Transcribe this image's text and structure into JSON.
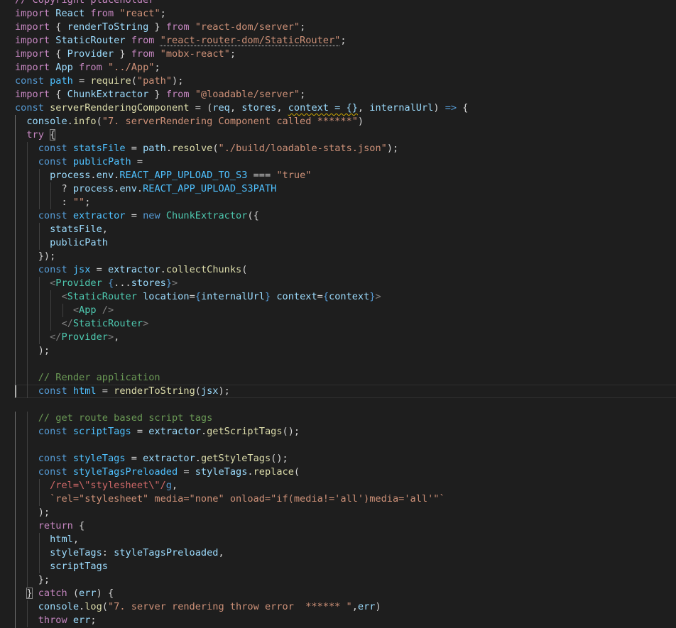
{
  "editor": {
    "language": "javascript",
    "cursor_line": 29,
    "lines": [
      {
        "indent": 0,
        "tokens": [
          [
            "ctl",
            "// Copyright placeholder "
          ]
        ]
      },
      {
        "indent": 0,
        "tokens": [
          [
            "ctl",
            "import"
          ],
          [
            "pl",
            " "
          ],
          [
            "var",
            "React"
          ],
          [
            "pl",
            " "
          ],
          [
            "ctl",
            "from"
          ],
          [
            "pl",
            " "
          ],
          [
            "str",
            "\"react\""
          ],
          [
            "pl",
            ";"
          ]
        ]
      },
      {
        "indent": 0,
        "tokens": [
          [
            "ctl",
            "import"
          ],
          [
            "pl",
            " { "
          ],
          [
            "var",
            "renderToString"
          ],
          [
            "pl",
            " } "
          ],
          [
            "ctl",
            "from"
          ],
          [
            "pl",
            " "
          ],
          [
            "str",
            "\"react-dom/server\""
          ],
          [
            "pl",
            ";"
          ]
        ]
      },
      {
        "indent": 0,
        "tokens": [
          [
            "ctl",
            "import"
          ],
          [
            "pl",
            " "
          ],
          [
            "var",
            "StaticRouter"
          ],
          [
            "pl",
            " "
          ],
          [
            "ctl",
            "from"
          ],
          [
            "pl",
            " "
          ],
          [
            "str",
            "\"react-router-dom/StaticRouter\"",
            "dots"
          ],
          [
            "pl",
            ";"
          ]
        ]
      },
      {
        "indent": 0,
        "tokens": [
          [
            "ctl",
            "import"
          ],
          [
            "pl",
            " { "
          ],
          [
            "var",
            "Provider"
          ],
          [
            "pl",
            " } "
          ],
          [
            "ctl",
            "from"
          ],
          [
            "pl",
            " "
          ],
          [
            "str",
            "\"mobx-react\""
          ],
          [
            "pl",
            ";"
          ]
        ]
      },
      {
        "indent": 0,
        "tokens": [
          [
            "ctl",
            "import"
          ],
          [
            "pl",
            " "
          ],
          [
            "var",
            "App"
          ],
          [
            "pl",
            " "
          ],
          [
            "ctl",
            "from"
          ],
          [
            "pl",
            " "
          ],
          [
            "str",
            "\"../App\""
          ],
          [
            "pl",
            ";"
          ]
        ]
      },
      {
        "indent": 0,
        "tokens": [
          [
            "kw",
            "const"
          ],
          [
            "pl",
            " "
          ],
          [
            "cst",
            "path"
          ],
          [
            "pl",
            " = "
          ],
          [
            "fn",
            "require"
          ],
          [
            "pl",
            "("
          ],
          [
            "str",
            "\"path\""
          ],
          [
            "pl",
            ");"
          ]
        ]
      },
      {
        "indent": 0,
        "tokens": [
          [
            "ctl",
            "import"
          ],
          [
            "pl",
            " { "
          ],
          [
            "var",
            "ChunkExtractor"
          ],
          [
            "pl",
            " } "
          ],
          [
            "ctl",
            "from"
          ],
          [
            "pl",
            " "
          ],
          [
            "str",
            "\"@loadable/server\""
          ],
          [
            "pl",
            ";"
          ]
        ]
      },
      {
        "indent": 0,
        "tokens": [
          [
            "kw",
            "const"
          ],
          [
            "pl",
            " "
          ],
          [
            "fn",
            "serverRenderingComponent"
          ],
          [
            "pl",
            " = ("
          ],
          [
            "var",
            "req"
          ],
          [
            "pl",
            ", "
          ],
          [
            "var",
            "stores"
          ],
          [
            "pl",
            ", "
          ],
          [
            "var",
            "context = {}",
            "squig"
          ],
          [
            "pl",
            ", "
          ],
          [
            "var",
            "internalUrl"
          ],
          [
            "pl",
            ") "
          ],
          [
            "kw",
            "=>"
          ],
          [
            "pl",
            " {"
          ]
        ]
      },
      {
        "indent": 1,
        "tokens": [
          [
            "var",
            "console"
          ],
          [
            "pl",
            "."
          ],
          [
            "fn",
            "info"
          ],
          [
            "pl",
            "("
          ],
          [
            "str",
            "\"7. serverRendering Component called ******\""
          ],
          [
            "pl",
            ")"
          ]
        ]
      },
      {
        "indent": 1,
        "tokens": [
          [
            "ctl",
            "try"
          ],
          [
            "pl",
            " "
          ],
          [
            "pl",
            "{",
            "bm"
          ]
        ]
      },
      {
        "indent": 2,
        "tokens": [
          [
            "kw",
            "const"
          ],
          [
            "pl",
            " "
          ],
          [
            "cst",
            "statsFile"
          ],
          [
            "pl",
            " = "
          ],
          [
            "var",
            "path"
          ],
          [
            "pl",
            "."
          ],
          [
            "fn",
            "resolve"
          ],
          [
            "pl",
            "("
          ],
          [
            "str",
            "\"./build/loadable-stats.json\""
          ],
          [
            "pl",
            ");"
          ]
        ]
      },
      {
        "indent": 2,
        "tokens": [
          [
            "kw",
            "const"
          ],
          [
            "pl",
            " "
          ],
          [
            "cst",
            "publicPath"
          ],
          [
            "pl",
            " ="
          ]
        ]
      },
      {
        "indent": 3,
        "tokens": [
          [
            "var",
            "process"
          ],
          [
            "pl",
            "."
          ],
          [
            "var",
            "env"
          ],
          [
            "pl",
            "."
          ],
          [
            "cst",
            "REACT_APP_UPLOAD_TO_S3"
          ],
          [
            "pl",
            " === "
          ],
          [
            "str",
            "\"true\""
          ]
        ]
      },
      {
        "indent": 4,
        "tokens": [
          [
            "pl",
            "? "
          ],
          [
            "var",
            "process"
          ],
          [
            "pl",
            "."
          ],
          [
            "var",
            "env"
          ],
          [
            "pl",
            "."
          ],
          [
            "cst",
            "REACT_APP_UPLOAD_S3PATH"
          ]
        ]
      },
      {
        "indent": 4,
        "tokens": [
          [
            "pl",
            ": "
          ],
          [
            "str",
            "\"\""
          ],
          [
            "pl",
            ";"
          ]
        ]
      },
      {
        "indent": 2,
        "tokens": [
          [
            "kw",
            "const"
          ],
          [
            "pl",
            " "
          ],
          [
            "cst",
            "extractor"
          ],
          [
            "pl",
            " = "
          ],
          [
            "kw",
            "new"
          ],
          [
            "pl",
            " "
          ],
          [
            "cls",
            "ChunkExtractor"
          ],
          [
            "pl",
            "({"
          ]
        ]
      },
      {
        "indent": 3,
        "tokens": [
          [
            "var",
            "statsFile"
          ],
          [
            "pl",
            ","
          ]
        ]
      },
      {
        "indent": 3,
        "tokens": [
          [
            "var",
            "publicPath"
          ]
        ]
      },
      {
        "indent": 2,
        "tokens": [
          [
            "pl",
            "});"
          ]
        ]
      },
      {
        "indent": 2,
        "tokens": [
          [
            "kw",
            "const"
          ],
          [
            "pl",
            " "
          ],
          [
            "cst",
            "jsx"
          ],
          [
            "pl",
            " = "
          ],
          [
            "var",
            "extractor"
          ],
          [
            "pl",
            "."
          ],
          [
            "fn",
            "collectChunks"
          ],
          [
            "pl",
            "("
          ]
        ]
      },
      {
        "indent": 3,
        "tokens": [
          [
            "tag",
            "<"
          ],
          [
            "cls",
            "Provider"
          ],
          [
            "pl",
            " "
          ],
          [
            "kw",
            "{"
          ],
          [
            "pl",
            "..."
          ],
          [
            "var",
            "stores"
          ],
          [
            "kw",
            "}"
          ],
          [
            "tag",
            ">"
          ]
        ]
      },
      {
        "indent": 4,
        "tokens": [
          [
            "tag",
            "<"
          ],
          [
            "cls",
            "StaticRouter"
          ],
          [
            "pl",
            " "
          ],
          [
            "var",
            "location"
          ],
          [
            "pl",
            "="
          ],
          [
            "kw",
            "{"
          ],
          [
            "var",
            "internalUrl"
          ],
          [
            "kw",
            "}"
          ],
          [
            "pl",
            " "
          ],
          [
            "var",
            "context"
          ],
          [
            "pl",
            "="
          ],
          [
            "kw",
            "{"
          ],
          [
            "var",
            "context"
          ],
          [
            "kw",
            "}"
          ],
          [
            "tag",
            ">"
          ]
        ]
      },
      {
        "indent": 5,
        "tokens": [
          [
            "tag",
            "<"
          ],
          [
            "cls",
            "App"
          ],
          [
            "pl",
            " "
          ],
          [
            "tag",
            "/>"
          ]
        ]
      },
      {
        "indent": 4,
        "tokens": [
          [
            "tag",
            "</"
          ],
          [
            "cls",
            "StaticRouter"
          ],
          [
            "tag",
            ">"
          ]
        ]
      },
      {
        "indent": 3,
        "tokens": [
          [
            "tag",
            "</"
          ],
          [
            "cls",
            "Provider"
          ],
          [
            "tag",
            ">"
          ],
          [
            "pl",
            ","
          ]
        ]
      },
      {
        "indent": 2,
        "tokens": [
          [
            "pl",
            ");"
          ]
        ]
      },
      {
        "indent": 2,
        "tokens": []
      },
      {
        "indent": 2,
        "tokens": [
          [
            "cmt",
            "// Render application"
          ]
        ]
      },
      {
        "indent": 2,
        "tokens": [
          [
            "kw",
            "const"
          ],
          [
            "pl",
            " "
          ],
          [
            "cst",
            "html"
          ],
          [
            "pl",
            " = "
          ],
          [
            "fn",
            "renderToString"
          ],
          [
            "pl",
            "("
          ],
          [
            "var",
            "jsx"
          ],
          [
            "pl",
            ");"
          ]
        ]
      },
      {
        "indent": 0,
        "tokens": []
      },
      {
        "indent": 2,
        "tokens": [
          [
            "cmt",
            "// get route based script tags"
          ]
        ]
      },
      {
        "indent": 2,
        "tokens": [
          [
            "kw",
            "const"
          ],
          [
            "pl",
            " "
          ],
          [
            "cst",
            "scriptTags"
          ],
          [
            "pl",
            " = "
          ],
          [
            "var",
            "extractor"
          ],
          [
            "pl",
            "."
          ],
          [
            "fn",
            "getScriptTags"
          ],
          [
            "pl",
            "();"
          ]
        ]
      },
      {
        "indent": 2,
        "tokens": []
      },
      {
        "indent": 2,
        "tokens": [
          [
            "kw",
            "const"
          ],
          [
            "pl",
            " "
          ],
          [
            "cst",
            "styleTags"
          ],
          [
            "pl",
            " = "
          ],
          [
            "var",
            "extractor"
          ],
          [
            "pl",
            "."
          ],
          [
            "fn",
            "getStyleTags"
          ],
          [
            "pl",
            "();"
          ]
        ]
      },
      {
        "indent": 2,
        "tokens": [
          [
            "kw",
            "const"
          ],
          [
            "pl",
            " "
          ],
          [
            "cst",
            "styleTagsPreloaded"
          ],
          [
            "pl",
            " = "
          ],
          [
            "var",
            "styleTags"
          ],
          [
            "pl",
            "."
          ],
          [
            "fn",
            "replace"
          ],
          [
            "pl",
            "("
          ]
        ]
      },
      {
        "indent": 3,
        "tokens": [
          [
            "rgx",
            "/rel=\\\"stylesheet\\\"/"
          ],
          [
            "kw",
            "g"
          ],
          [
            "pl",
            ","
          ]
        ]
      },
      {
        "indent": 3,
        "tokens": [
          [
            "str",
            "`rel=\"stylesheet\" media=\"none\" onload=\"if(media!='all')media='all'\"`"
          ]
        ]
      },
      {
        "indent": 2,
        "tokens": [
          [
            "pl",
            ");"
          ]
        ]
      },
      {
        "indent": 2,
        "tokens": [
          [
            "ctl",
            "return"
          ],
          [
            "pl",
            " {"
          ]
        ]
      },
      {
        "indent": 3,
        "tokens": [
          [
            "var",
            "html"
          ],
          [
            "pl",
            ","
          ]
        ]
      },
      {
        "indent": 3,
        "tokens": [
          [
            "var",
            "styleTags"
          ],
          [
            "pl",
            ": "
          ],
          [
            "var",
            "styleTagsPreloaded"
          ],
          [
            "pl",
            ","
          ]
        ]
      },
      {
        "indent": 3,
        "tokens": [
          [
            "var",
            "scriptTags"
          ]
        ]
      },
      {
        "indent": 2,
        "tokens": [
          [
            "pl",
            "};"
          ]
        ]
      },
      {
        "indent": 1,
        "tokens": [
          [
            "pl",
            "}",
            "bm"
          ],
          [
            "pl",
            " "
          ],
          [
            "ctl",
            "catch"
          ],
          [
            "pl",
            " ("
          ],
          [
            "var",
            "err"
          ],
          [
            "pl",
            ") {"
          ]
        ]
      },
      {
        "indent": 2,
        "tokens": [
          [
            "var",
            "console"
          ],
          [
            "pl",
            "."
          ],
          [
            "fn",
            "log"
          ],
          [
            "pl",
            "("
          ],
          [
            "str",
            "\"7. server rendering throw error  ****** \""
          ],
          [
            "pl",
            ","
          ],
          [
            "var",
            "err"
          ],
          [
            "pl",
            ")"
          ]
        ]
      },
      {
        "indent": 2,
        "tokens": [
          [
            "ctl",
            "throw"
          ],
          [
            "pl",
            " "
          ],
          [
            "var",
            "err"
          ],
          [
            "pl",
            ";"
          ]
        ]
      },
      {
        "indent": 1,
        "tokens": [
          [
            "pl",
            "}"
          ]
        ]
      }
    ]
  }
}
